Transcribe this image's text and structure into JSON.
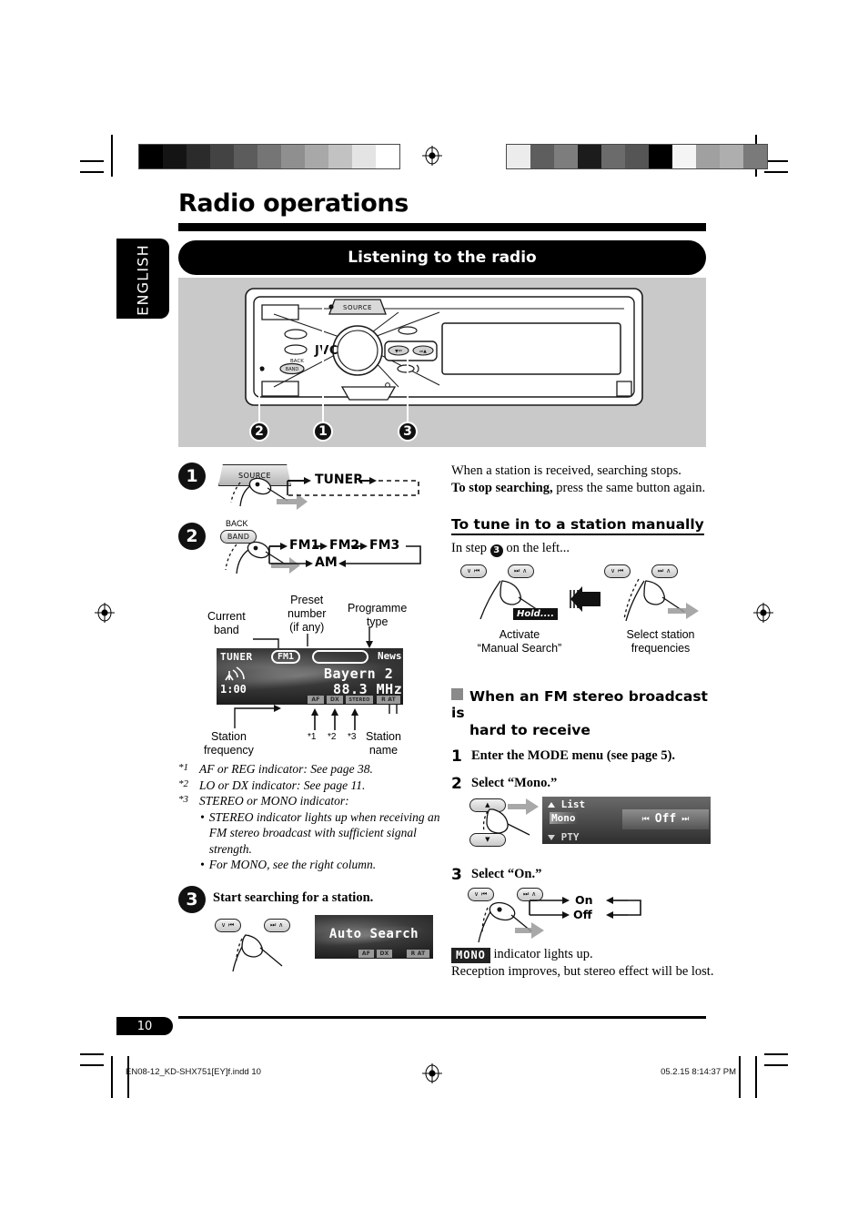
{
  "page": {
    "title": "Radio operations",
    "language_tab": "ENGLISH",
    "section_bar": "Listening to the radio",
    "page_number": "10",
    "footer_left": "EN08-12_KD-SHX751[EY]f.indd   10",
    "footer_right": "05.2.15   8:14:37 PM"
  },
  "unit": {
    "brand": "JVC",
    "source_button": "SOURCE",
    "back_label": "BACK",
    "band_button": "BAND",
    "callouts": [
      "2",
      "1",
      "3"
    ]
  },
  "steps": {
    "step1": {
      "num": "1",
      "button": "SOURCE",
      "flow": "TUNER"
    },
    "step2": {
      "num": "2",
      "back_label": "BACK",
      "button": "BAND",
      "flow_top": [
        "FM1",
        "FM2",
        "FM3"
      ],
      "flow_bottom": "AM",
      "callouts": {
        "current_band": "Current\nband",
        "preset_number": "Preset\nnumber\n(if any)",
        "programme_type": "Programme\ntype",
        "station_frequency": "Station\nfrequency",
        "station_name": "Station\nname"
      },
      "display": {
        "source": "TUNER",
        "band": "FM1",
        "programme_type": "News",
        "station_name": "Bayern 2",
        "frequency": "88.3 MHz",
        "clock": "1:00",
        "indicators": [
          "AF",
          "DX",
          "STEREO"
        ],
        "indicator_right": "R AT"
      },
      "marks": [
        "*1",
        "*2",
        "*3"
      ],
      "footnotes": [
        "AF or REG indicator: See page 38.",
        "LO or DX indicator: See page 11.",
        "STEREO or MONO indicator:"
      ],
      "footnote_marks": [
        "*1",
        "*2",
        "*3"
      ],
      "footnote_bullets": [
        "STEREO indicator lights up when receiving an FM stereo broadcast with sufficient signal strength.",
        "For MONO, see the right column."
      ]
    },
    "step3": {
      "num": "3",
      "heading": "Start searching for a station.",
      "button_left": "∨ ⏮",
      "button_right": "⏭ ∧",
      "display": {
        "text": "Auto Search",
        "indicators": [
          "AF",
          "DX"
        ],
        "indicator_right": "R AT"
      }
    }
  },
  "right": {
    "intro": {
      "line1": "When a station is received, searching stops.",
      "bold": "To stop searching,",
      "line2": " press the same button again."
    },
    "manual": {
      "heading": "To tune in to a station manually",
      "instruction_pre": "In step ",
      "instruction_step": "3",
      "instruction_post": " on the left...",
      "hold_badge": "Hold....",
      "caption_left_1": "Activate",
      "caption_left_2": "“Manual Search”",
      "caption_right_1": "Select station",
      "caption_right_2": "frequencies",
      "button_left": "∨ ⏮",
      "button_right": "⏭ ∧"
    },
    "fm_stereo": {
      "heading_line1": "When an FM stereo broadcast is",
      "heading_line2": "hard to receive",
      "step1_num": "1",
      "step1_text": "Enter the MODE menu (see page 5).",
      "step2_num": "2",
      "step2_text": "Select “Mono.”",
      "menu_display": {
        "item_above": "List",
        "item_selected": "Mono",
        "item_below": "PTY",
        "value": "Off"
      },
      "step3_num": "3",
      "step3_text": "Select “On.”",
      "toggle_on": "On",
      "toggle_off": "Off",
      "mono_badge": "MONO",
      "result_line1": " indicator lights up.",
      "result_line2": "Reception improves, but stereo effect will be lost.",
      "button_left": "∨ ⏮",
      "button_right": "⏭ ∧"
    }
  },
  "colors": {
    "panel_gray": "#c9c9c9",
    "black": "#000000",
    "lcd_dark": "#1a1a1a",
    "indicator_gray": "#9a9a9a"
  }
}
